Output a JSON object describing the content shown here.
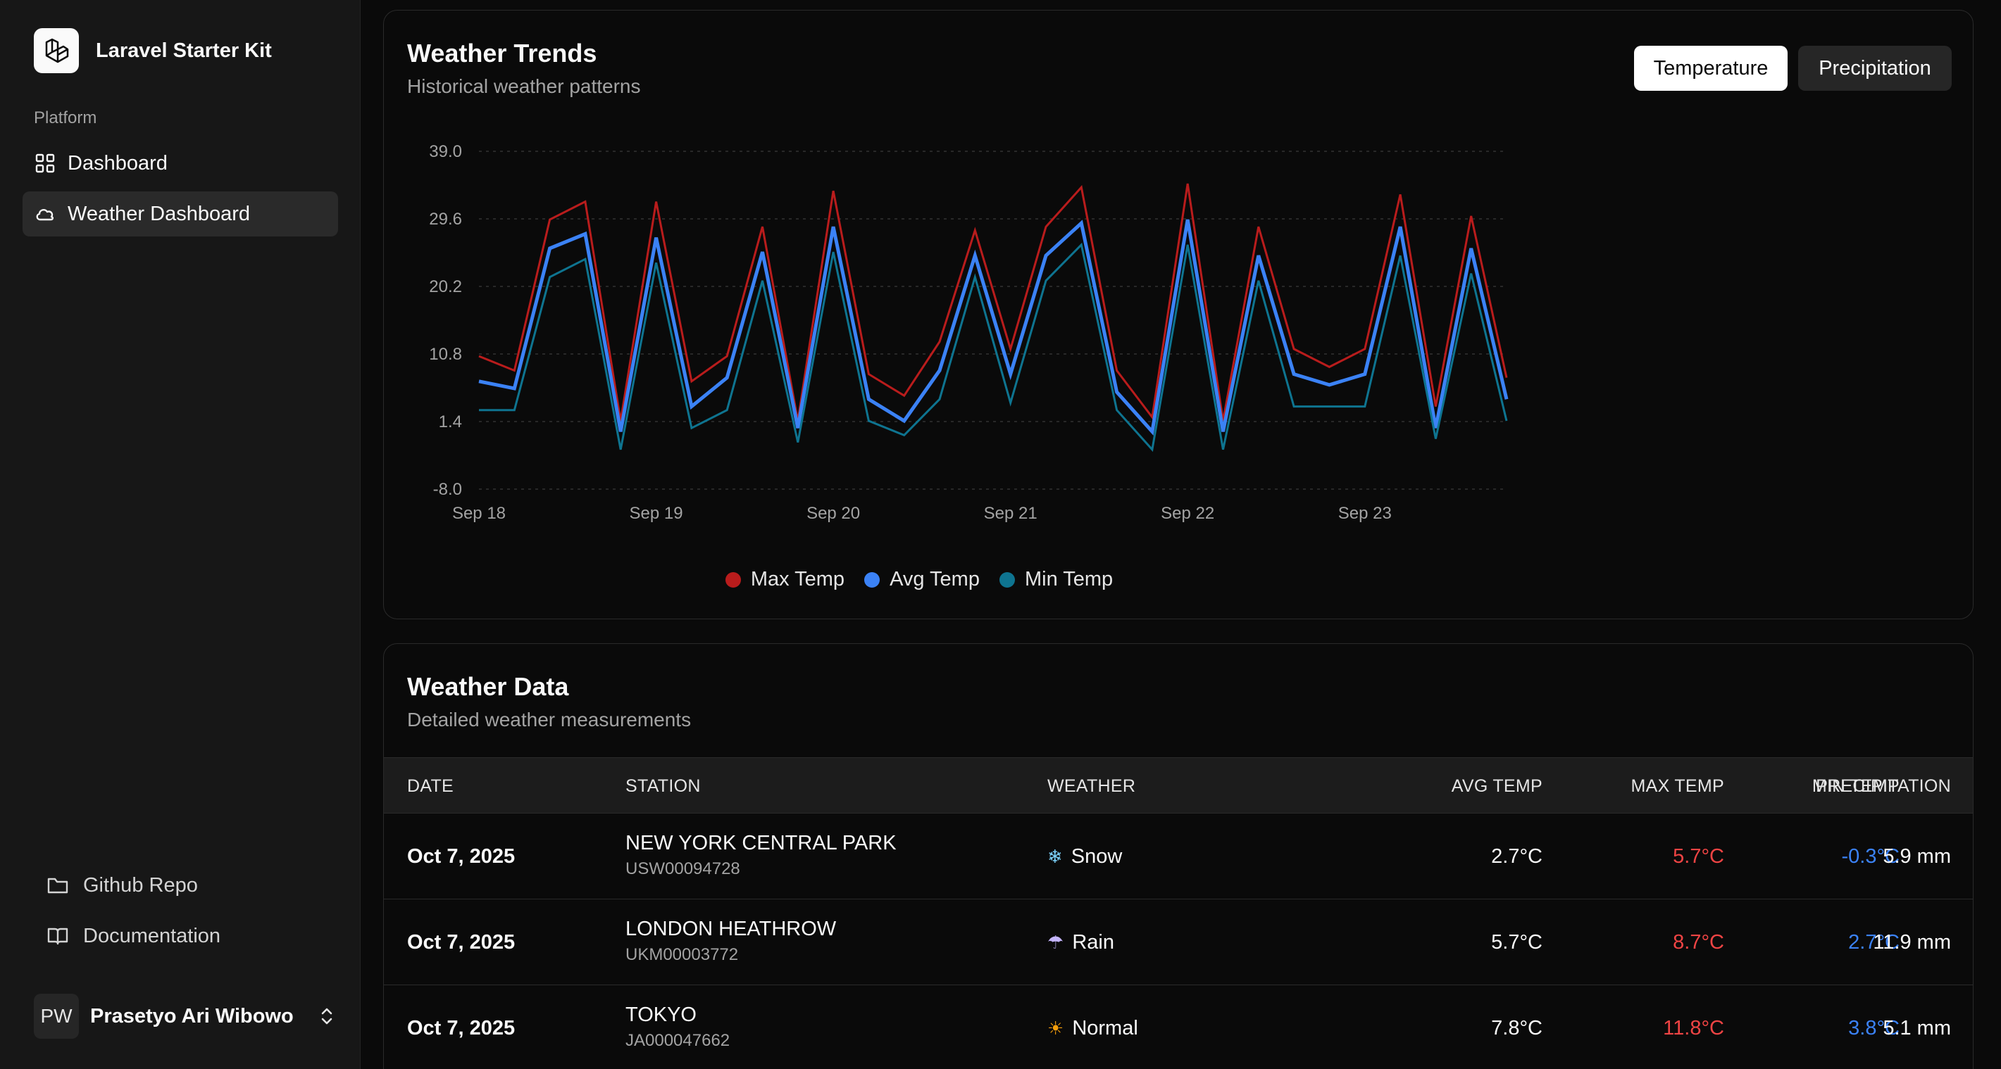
{
  "brand": {
    "name": "Laravel Starter Kit"
  },
  "sidebar": {
    "section_label": "Platform",
    "items": [
      {
        "label": "Dashboard",
        "icon": "grid-icon",
        "active": false
      },
      {
        "label": "Weather Dashboard",
        "icon": "cloud-icon",
        "active": true
      }
    ],
    "footer_links": [
      {
        "label": "Github Repo",
        "icon": "folder-icon"
      },
      {
        "label": "Documentation",
        "icon": "book-icon"
      }
    ],
    "user": {
      "initials": "PW",
      "name": "Prasetyo Ari Wibowo"
    }
  },
  "trends": {
    "title": "Weather Trends",
    "subtitle": "Historical weather patterns",
    "buttons": {
      "temperature": "Temperature",
      "precipitation": "Precipitation"
    }
  },
  "chart_data": {
    "type": "line",
    "ylim": [
      -8.0,
      39.0
    ],
    "yticks": [
      "39.0",
      "29.6",
      "20.2",
      "10.8",
      "1.4",
      "-8.0"
    ],
    "xticks": [
      "Sep 18",
      "Sep 19",
      "Sep 20",
      "Sep 21",
      "Sep 22",
      "Sep 23"
    ],
    "grid": true,
    "legend_position": "bottom",
    "series": [
      {
        "name": "Max Temp",
        "color": "#b91c1c",
        "values": [
          10.5,
          8.5,
          29.5,
          32,
          1.5,
          32,
          7,
          10.5,
          28.5,
          1.5,
          33.5,
          8,
          5,
          12.5,
          28,
          11.5,
          28.5,
          34,
          8.5,
          2,
          34.5,
          1.5,
          28.5,
          11.5,
          9,
          11.5,
          33,
          3.5,
          30,
          7.5
        ]
      },
      {
        "name": "Avg Temp",
        "color": "#3b82f6",
        "values": [
          7,
          6,
          25.5,
          27.5,
          0,
          27,
          3.5,
          7.5,
          25,
          0.5,
          28.5,
          4.5,
          1.5,
          8.5,
          24.5,
          8,
          24.5,
          29,
          5.5,
          0,
          29.5,
          0,
          24.5,
          8,
          6.5,
          8,
          28.5,
          0.5,
          25.5,
          4.5
        ]
      },
      {
        "name": "Min Temp",
        "color": "#0e7490",
        "values": [
          3,
          3,
          21.5,
          24,
          -2.5,
          23.5,
          0.5,
          3,
          21,
          -1.5,
          25,
          1.5,
          -0.5,
          4.5,
          21.5,
          4,
          21,
          26,
          3,
          -2.5,
          26,
          -2.5,
          21,
          3.5,
          3.5,
          3.5,
          24.5,
          -1,
          22,
          1.5
        ]
      }
    ]
  },
  "table": {
    "title": "Weather Data",
    "subtitle": "Detailed weather measurements",
    "headers": {
      "date": "DATE",
      "station": "STATION",
      "weather": "WEATHER",
      "avg": "AVG TEMP",
      "max": "MAX TEMP",
      "min": "MIN TEMP",
      "precip": "PRECIPITATION"
    },
    "rows": [
      {
        "date": "Oct 7, 2025",
        "station": "NEW YORK CENTRAL PARK",
        "station_id": "USW00094728",
        "weather": "Snow",
        "weather_icon": "❄",
        "avg": "2.7°C",
        "max": "5.7°C",
        "min": "-0.3°C",
        "precip": "5.9 mm"
      },
      {
        "date": "Oct 7, 2025",
        "station": "LONDON HEATHROW",
        "station_id": "UKM00003772",
        "weather": "Rain",
        "weather_icon": "☂",
        "avg": "5.7°C",
        "max": "8.7°C",
        "min": "2.7°C",
        "precip": "11.9 mm"
      },
      {
        "date": "Oct 7, 2025",
        "station": "TOKYO",
        "station_id": "JA000047662",
        "weather": "Normal",
        "weather_icon": "☀",
        "avg": "7.8°C",
        "max": "11.8°C",
        "min": "3.8°C",
        "precip": "5.1 mm"
      }
    ]
  }
}
